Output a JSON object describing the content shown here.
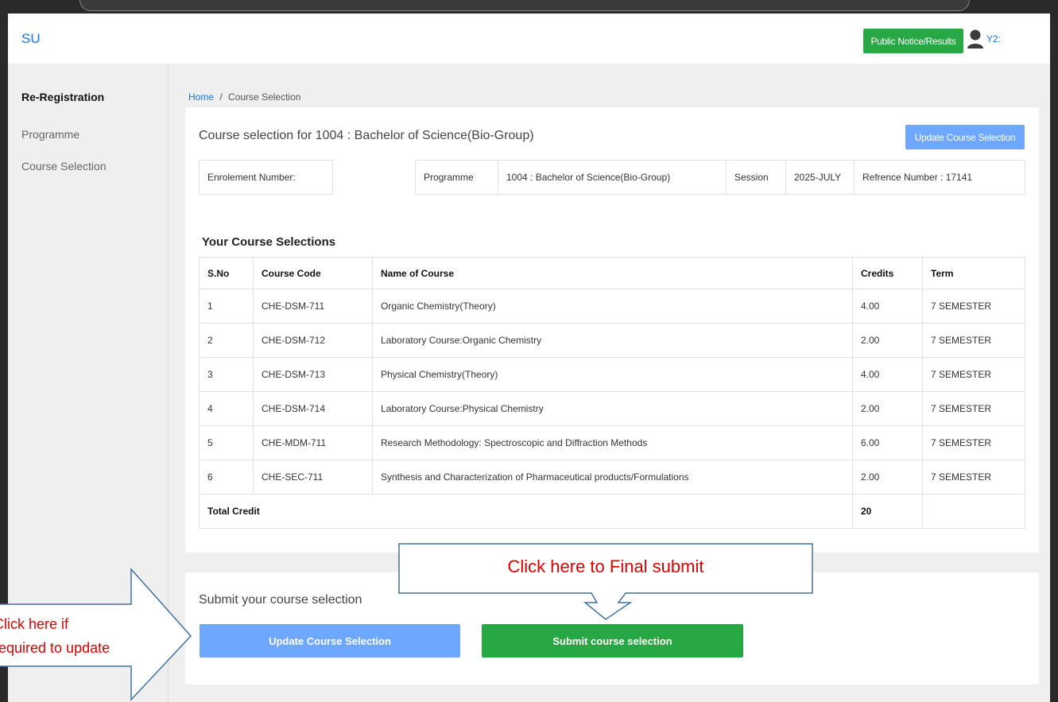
{
  "navbar": {
    "brand": "SU",
    "notice_button": "Public Notice/Results",
    "user_label": "Y2:"
  },
  "sidebar": {
    "heading": "Re-Registration",
    "items": [
      {
        "label": "Programme"
      },
      {
        "label": "Course Selection"
      }
    ]
  },
  "breadcrumb": {
    "home": "Home",
    "separator": "/",
    "current": "Course Selection"
  },
  "course_card": {
    "title": "Course selection for 1004 : Bachelor of Science(Bio-Group)",
    "update_button": "Update Course Selection",
    "info": {
      "enrolment_label": "Enrolement Number:",
      "programme_label": "Programme",
      "programme_value": "1004 : Bachelor of Science(Bio-Group)",
      "session_label": "Session",
      "session_value": "2025-JULY",
      "reference": "Refrence Number : 17141"
    },
    "selections_title": "Your Course Selections",
    "columns": [
      "S.No",
      "Course Code",
      "Name of Course",
      "Credits",
      "Term"
    ],
    "rows": [
      {
        "sno": "1",
        "code": "CHE-DSM-711",
        "name": "Organic Chemistry(Theory)",
        "credits": "4.00",
        "term": "7 SEMESTER"
      },
      {
        "sno": "2",
        "code": "CHE-DSM-712",
        "name": "Laboratory Course:Organic Chemistry",
        "credits": "2.00",
        "term": "7 SEMESTER"
      },
      {
        "sno": "3",
        "code": "CHE-DSM-713",
        "name": "Physical Chemistry(Theory)",
        "credits": "4.00",
        "term": "7 SEMESTER"
      },
      {
        "sno": "4",
        "code": "CHE-DSM-714",
        "name": "Laboratory Course:Physical Chemistry",
        "credits": "2.00",
        "term": "7 SEMESTER"
      },
      {
        "sno": "5",
        "code": "CHE-MDM-711",
        "name": "Research Methodology: Spectroscopic and Diffraction Methods",
        "credits": "6.00",
        "term": "7 SEMESTER"
      },
      {
        "sno": "6",
        "code": "CHE-SEC-711",
        "name": "Synthesis and Characterization of Pharmaceutical products/Formulations",
        "credits": "2.00",
        "term": "7 SEMESTER"
      }
    ],
    "total_label": "Total Credit",
    "total_value": "20"
  },
  "submit_card": {
    "title": "Submit your course selection",
    "update_button": "Update Course Selection",
    "submit_button": "Submit course selection"
  },
  "annotations": {
    "final_submit": "Click here to Final submit",
    "update_line1": "Click here if",
    "update_line2": "required to update"
  },
  "colors": {
    "brand_blue": "#1a73e8",
    "success_green": "#28a745",
    "light_blue_button": "#6ea8fe",
    "annotation_red": "#e00000",
    "annotation_outline": "#41719c"
  }
}
